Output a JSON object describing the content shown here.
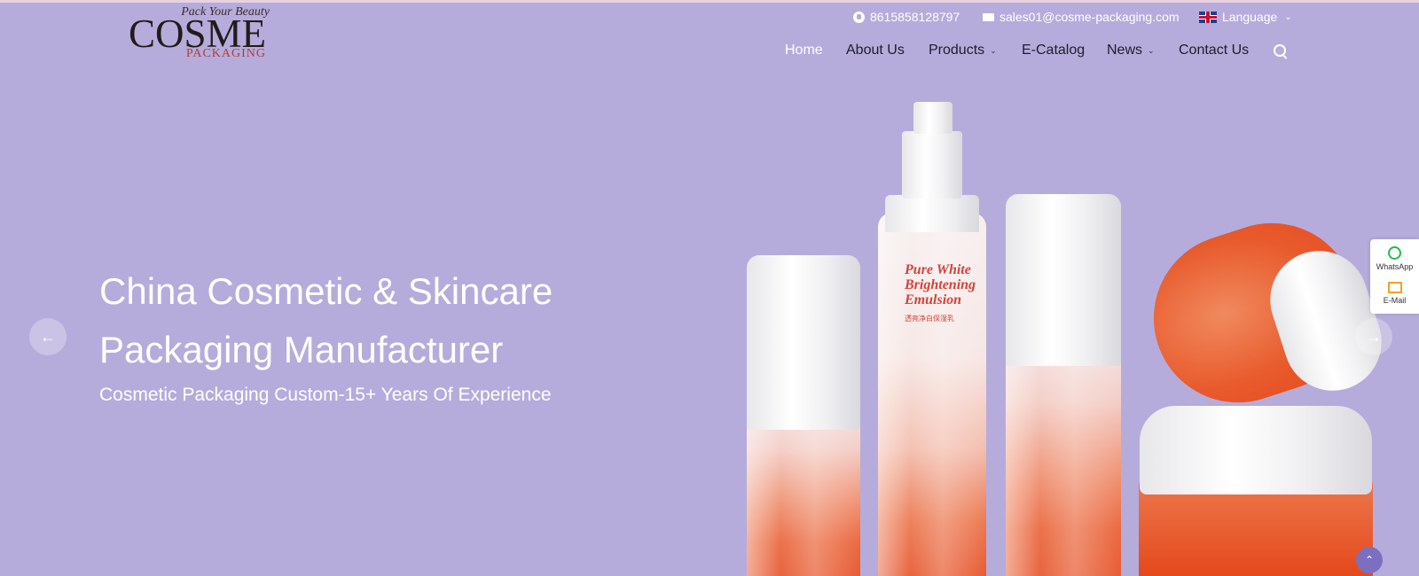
{
  "logo": {
    "tagline": "Pack Your Beauty",
    "name": "COSME",
    "sub": "PACKAGING"
  },
  "topbar": {
    "phone": "8615858128797",
    "email": "sales01@cosme-packaging.com",
    "language": "Language"
  },
  "nav": {
    "items": [
      {
        "label": "Home",
        "active": true,
        "dropdown": false
      },
      {
        "label": "About Us",
        "active": false,
        "dropdown": false
      },
      {
        "label": "Products",
        "active": false,
        "dropdown": true
      },
      {
        "label": "E-Catalog",
        "active": false,
        "dropdown": false
      },
      {
        "label": "News",
        "active": false,
        "dropdown": true
      },
      {
        "label": "Contact Us",
        "active": false,
        "dropdown": false
      }
    ],
    "search_icon": "search-icon"
  },
  "hero": {
    "title_line1": "China Cosmetic & Skincare",
    "title_line2": "Packaging Manufacturer",
    "subtitle": "Cosmetic Packaging Custom-15+ Years Of Experience",
    "product_label_1": "Pure White",
    "product_label_2": "Brightening",
    "product_label_3": "Emulsion",
    "product_label_cn": "透亮净白保湿乳"
  },
  "side_panel": {
    "whatsapp": "WhatsApp",
    "email": "E-Mail"
  },
  "colors": {
    "background": "#b6acdb",
    "accent": "#e4491c",
    "nav_text": "#1d1d2b",
    "whatsapp": "#22b94e",
    "email": "#f1a027"
  }
}
